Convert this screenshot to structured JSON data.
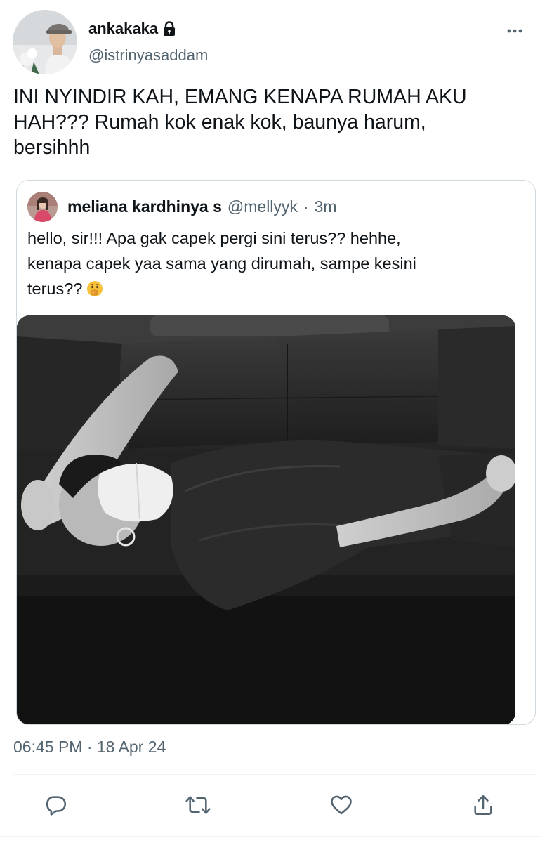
{
  "tweet": {
    "author": {
      "display_name": "ankakaka",
      "handle": "@istrinyasaddam",
      "protected_icon": "lock-icon"
    },
    "text": "INI NYINDIR KAH, EMANG KENAPA RUMAH AKU\nHAH??? Rumah kok enak kok, baunya harum,\nbersihhh",
    "timestamp": "06:45 PM · 18 Apr 24"
  },
  "quoted_tweet": {
    "display_name": "meliana kardhinya s",
    "handle": "@mellyyk",
    "separator": "·",
    "time": "3m",
    "text": "hello, sir!!! Apa gak capek pergi sini terus?? hehhe,\nkenapa capek yaa sama yang dirumah, sampe kesini\nterus??",
    "emoji": "shushing-face-emoji",
    "photo": "black-and-white photo of a person in a face mask lying on a leather sofa"
  },
  "actions": {
    "reply_icon": "reply-icon",
    "retweet_icon": "retweet-icon",
    "like_icon": "heart-icon",
    "share_icon": "share-icon"
  },
  "colors": {
    "text_primary": "#0f1419",
    "text_secondary": "#536471",
    "border": "#cfd9de"
  }
}
